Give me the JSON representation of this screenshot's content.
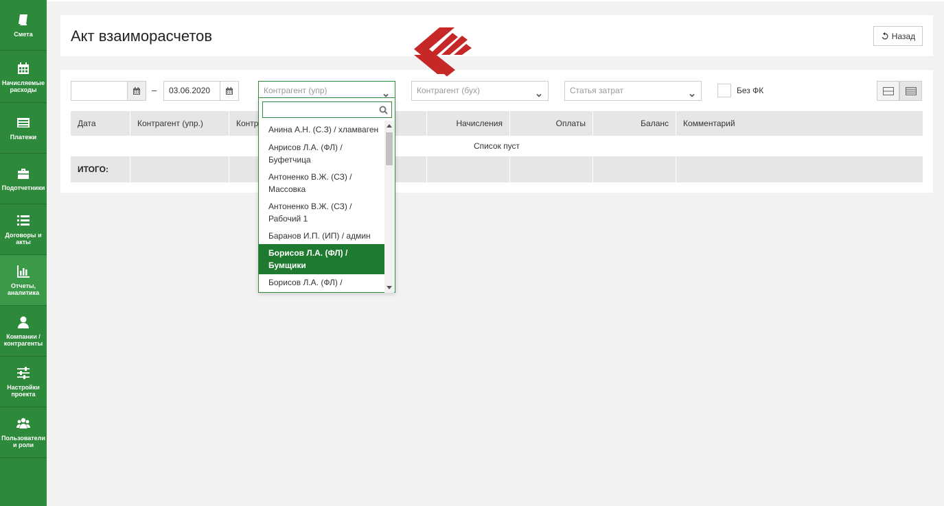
{
  "sidebar": {
    "items": [
      {
        "label": "Смета",
        "icon": "book-icon"
      },
      {
        "label": "Начисляемые расходы",
        "icon": "calendar-icon"
      },
      {
        "label": "Платежи",
        "icon": "list-card-icon"
      },
      {
        "label": "Подотчетники",
        "icon": "briefcase-icon"
      },
      {
        "label": "Договоры и акты",
        "icon": "list-icon"
      },
      {
        "label": "Отчеты, аналитика",
        "icon": "bar-chart-icon"
      },
      {
        "label": "Компании / контрагенты",
        "icon": "user-icon"
      },
      {
        "label": "Настройки проекта",
        "icon": "sliders-icon"
      },
      {
        "label": "Пользователи и роли",
        "icon": "users-icon"
      }
    ],
    "active_index": 5,
    "color": "#2d8a3a"
  },
  "header": {
    "title": "Акт взаиморасчетов",
    "back_label": "Назад"
  },
  "filters": {
    "date_from": "",
    "date_separator": "–",
    "date_to": "03.06.2020",
    "contractor_mgmt_placeholder": "Контрагент (упр)",
    "contractor_acc_placeholder": "Контрагент (бух)",
    "cost_item_placeholder": "Статья затрат",
    "no_fk_label": "Без ФК",
    "no_fk_checked": false
  },
  "table": {
    "columns": [
      "Дата",
      "Контрагент (упр.)",
      "Контр",
      "",
      "Начисления",
      "Оплаты",
      "Баланс",
      "Комментарий"
    ],
    "empty_text": "Список пуст",
    "total_label": "ИТОГО:"
  },
  "dropdown": {
    "search_value": "",
    "items": [
      "Анина А.Н. (С.З) / хламваген",
      "Анрисов Л.А. (ФЛ) / Буфетчица",
      "Антоненко В.Ж. (СЗ) / Массовка",
      "Антоненко В.Ж. (СЗ) / Рабочий 1",
      "Баранов И.П. (ИП) / админ",
      "Борисов Л.А. (ФЛ) / Бумщики",
      "Борисов Л.А. (ФЛ) / реквизиторщик"
    ],
    "selected_index": 5,
    "highlight_color": "#1e7a2e"
  },
  "logo": {
    "color": "#c62828",
    "icon": "chevron-arrows-logo"
  }
}
